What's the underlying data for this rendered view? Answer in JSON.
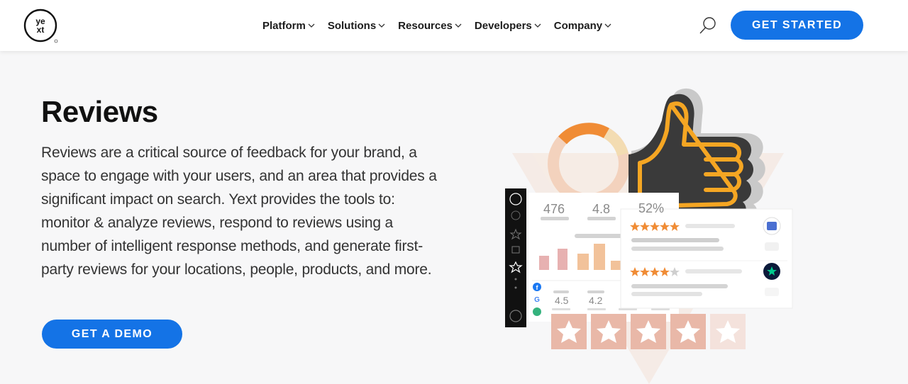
{
  "header": {
    "logo_text": "YEXT",
    "nav": [
      {
        "label": "Platform"
      },
      {
        "label": "Solutions"
      },
      {
        "label": "Resources"
      },
      {
        "label": "Developers"
      },
      {
        "label": "Company"
      }
    ],
    "cta_label": "GET STARTED"
  },
  "hero": {
    "title": "Reviews",
    "description": "Reviews are a critical source of feedback for your brand, a space to engage with your users, and an area that provides a significant impact on search. Yext provides the tools to: monitor & analyze reviews, respond to reviews using a number of intelligent response methods, and generate first-party reviews for your locations, people, products, and more.",
    "cta_label": "GET A DEMO"
  },
  "illustration": {
    "stats": [
      "476",
      "4.8",
      "52%"
    ],
    "source_ratings": [
      "4.5",
      "4.2"
    ],
    "review_ratings": [
      5,
      4
    ],
    "colors": {
      "accent": "#1473e6",
      "star": "#f08c35",
      "neon": "#f5a623"
    }
  }
}
